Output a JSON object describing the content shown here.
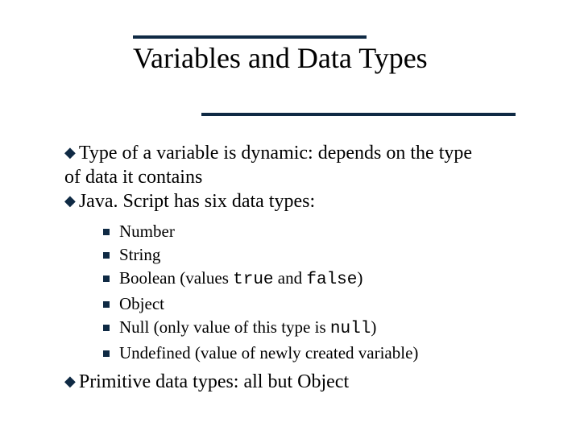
{
  "title": "Variables and Data Types",
  "bullets": {
    "b1a": "Type of a variable is dynamic: depends on the type",
    "b1b": "of data it contains",
    "b2": "Java. Script has six data types:",
    "b3": "Primitive data types: all but Object"
  },
  "sub": {
    "s1": "Number",
    "s2": "String",
    "s3a": "Boolean (values ",
    "s3_true": "true",
    "s3b": " and ",
    "s3_false": "false",
    "s3c": ")",
    "s4": "Object",
    "s5a": "Null (only value of this type is ",
    "s5_null": "null",
    "s5b": ")",
    "s6": "Undefined (value of newly created variable)"
  }
}
